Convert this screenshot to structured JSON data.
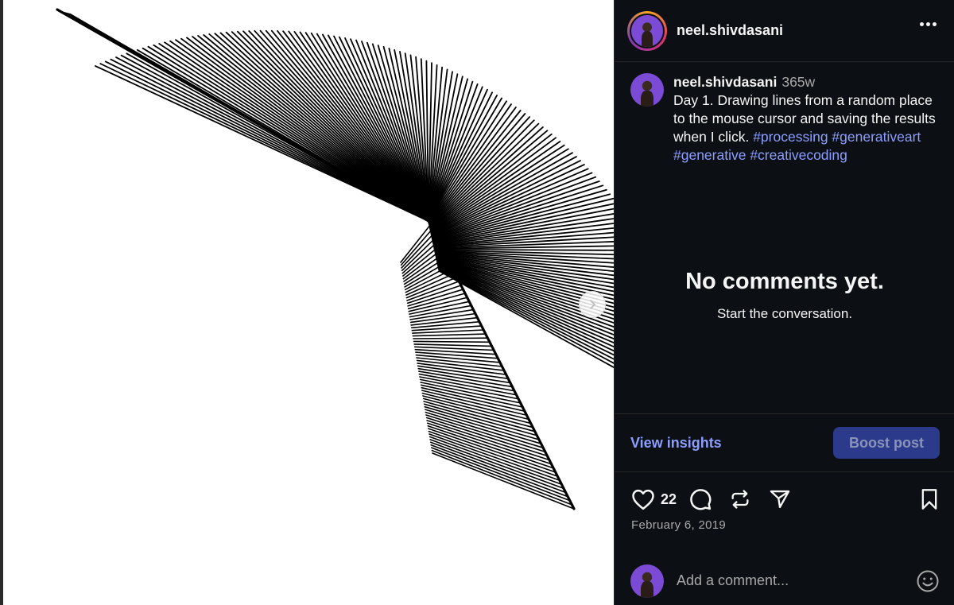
{
  "post": {
    "username": "neel.shivdasani",
    "time_ago": "365w",
    "caption_text": "Day 1. Drawing lines from a random place to the mouse cursor and saving the results when I click.",
    "hashtags": "#processing #generativeart #generative #creativecoding",
    "date": "February 6, 2019",
    "likes": "22"
  },
  "comments": {
    "empty_title": "No comments yet.",
    "empty_subtitle": "Start the conversation.",
    "input_placeholder": "Add a comment..."
  },
  "insights": {
    "view_label": "View insights",
    "boost_label": "Boost post"
  },
  "icons": {
    "more": "more-options-icon",
    "next": "chevron-right-icon",
    "like": "heart-icon",
    "comment": "comment-icon",
    "repost": "repost-icon",
    "share": "send-icon",
    "save": "bookmark-icon",
    "emoji": "emoji-icon"
  },
  "colors": {
    "panel_bg": "#0c1014",
    "link": "#8c9eff",
    "boost_bg": "#2c3a8c",
    "secondary_text": "#a8a8a8"
  }
}
